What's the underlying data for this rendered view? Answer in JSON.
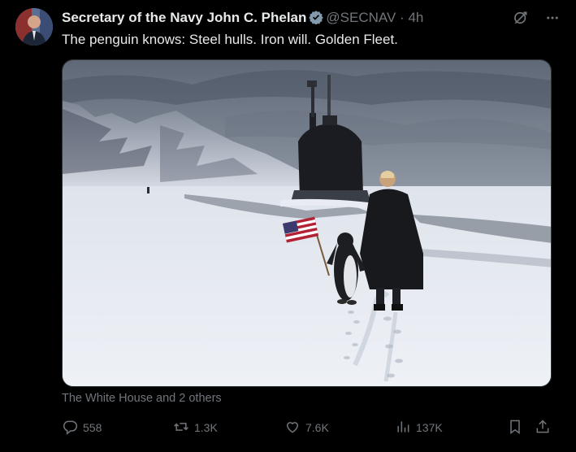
{
  "tweet": {
    "author_name": "Secretary of the Navy John C. Phelan",
    "handle": "@SECNAV",
    "separator": "·",
    "time": "4h",
    "text": "The penguin knows: Steel hulls. Iron will. Golden Fleet.",
    "tagged": "The White House and 2 others",
    "verified_color": "#829aab"
  },
  "icons": {
    "grok": "grok-icon",
    "more": "more-options-icon",
    "reply": "reply-icon",
    "retweet": "retweet-icon",
    "like": "like-icon",
    "views": "views-icon",
    "bookmark": "bookmark-icon",
    "share": "share-icon"
  },
  "actions": {
    "replies": "558",
    "reposts": "1.3K",
    "likes": "7.6K",
    "views": "137K"
  }
}
